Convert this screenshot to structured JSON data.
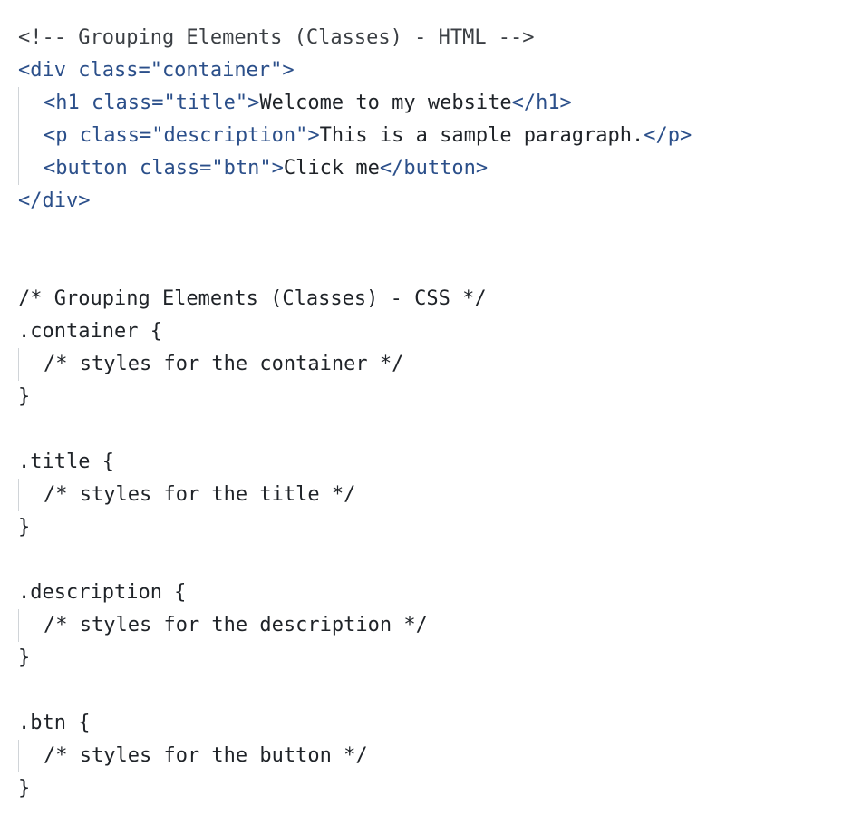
{
  "html_block": {
    "comment": "<!-- Grouping Elements (Classes) - HTML -->",
    "open_div": "<div class=\"container\">",
    "h1_open": "<h1 class=\"title\">",
    "h1_text": "Welcome to my website",
    "h1_close": "</h1>",
    "p_open": "<p class=\"description\">",
    "p_text": "This is a sample paragraph.",
    "p_close": "</p>",
    "button_open": "<button class=\"btn\">",
    "button_text": "Click me",
    "button_close": "</button>",
    "close_div": "</div>"
  },
  "css_block": {
    "comment": "/* Grouping Elements (Classes) - CSS */",
    "rules": [
      {
        "selector": ".container {",
        "body": "/* styles for the container */",
        "close": "}"
      },
      {
        "selector": ".title {",
        "body": "/* styles for the title */",
        "close": "}"
      },
      {
        "selector": ".description {",
        "body": "/* styles for the description */",
        "close": "}"
      },
      {
        "selector": ".btn {",
        "body": "/* styles for the button */",
        "close": "}"
      }
    ]
  },
  "colors": {
    "tag": "#2b4f8a",
    "comment": "#3b3f44",
    "text": "#1f2328",
    "indent_guide": "#d0d4d8",
    "background": "#ffffff"
  }
}
